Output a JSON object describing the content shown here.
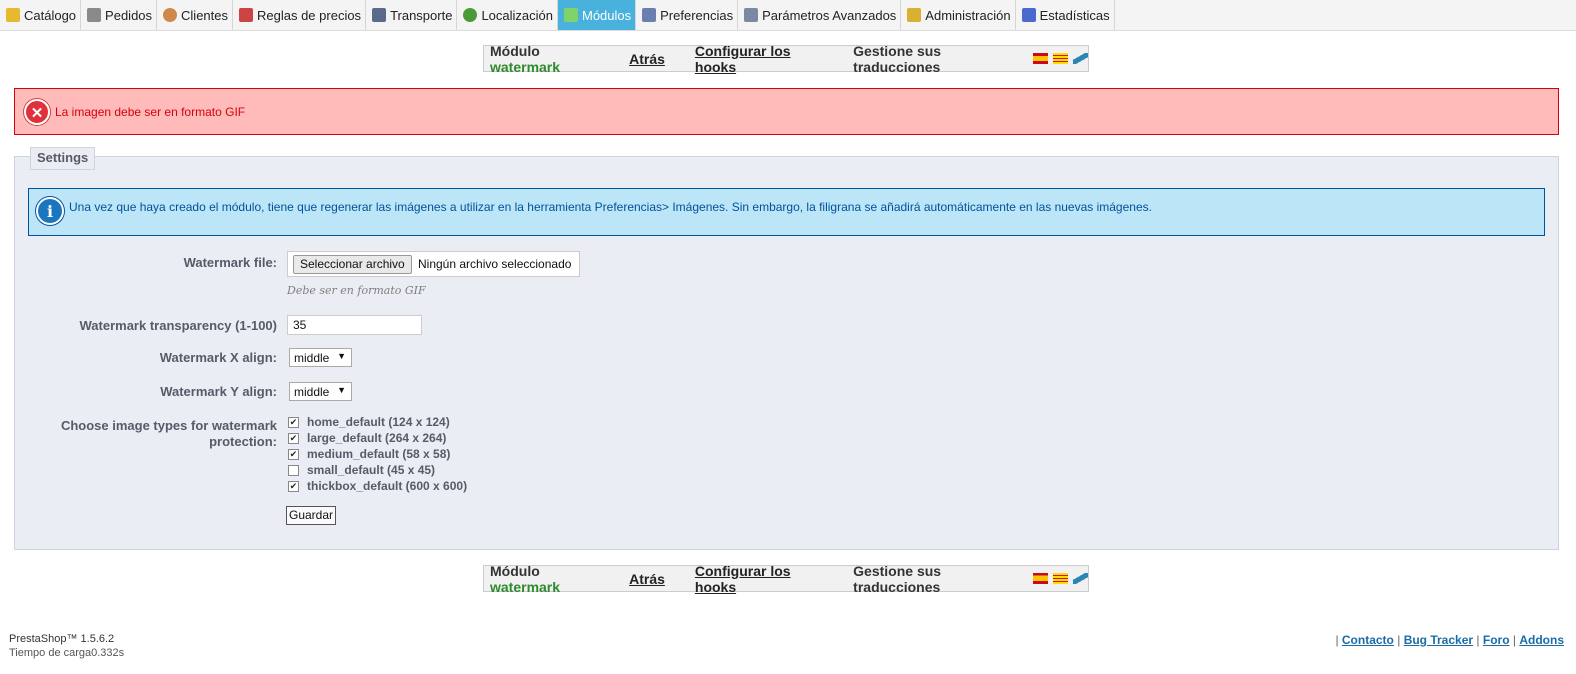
{
  "nav": {
    "tabs": [
      {
        "label": "Catálogo",
        "icon": "folder-icon",
        "color": "#e8b830"
      },
      {
        "label": "Pedidos",
        "icon": "cart-icon",
        "color": "#8a8a8a"
      },
      {
        "label": "Clientes",
        "icon": "user-icon",
        "color": "#d0884a"
      },
      {
        "label": "Reglas de precios",
        "icon": "price-tag-icon",
        "color": "#cc4444"
      },
      {
        "label": "Transporte",
        "icon": "truck-icon",
        "color": "#5a6a8a"
      },
      {
        "label": "Localización",
        "icon": "globe-icon",
        "color": "#4a9a3a"
      },
      {
        "label": "Módulos",
        "icon": "puzzle-icon",
        "color": "#7fd36a"
      },
      {
        "label": "Preferencias",
        "icon": "preferences-icon",
        "color": "#6a7fb0"
      },
      {
        "label": "Parámetros Avanzados",
        "icon": "wrench-icon",
        "color": "#7a8aa0"
      },
      {
        "label": "Administración",
        "icon": "key-icon",
        "color": "#d9b030"
      },
      {
        "label": "Estadísticas",
        "icon": "bar-chart-icon",
        "color": "#4a6ad0"
      }
    ],
    "active_index": 6,
    "active_color": "#49b2dc"
  },
  "module_bar": {
    "prefix": "Módulo",
    "module_name": "watermark",
    "back_label": "Atrás",
    "hooks_label": "Configurar los hooks",
    "translations_label": "Gestione sus traducciones",
    "flags": [
      "spain-flag-icon",
      "catalonia-flag-icon",
      "translate-feather-icon"
    ]
  },
  "error": {
    "message": "La imagen debe ser en formato GIF",
    "icon": "error-x-icon",
    "color": "#d8000c"
  },
  "settings": {
    "legend": "Settings",
    "info_message": "Una vez que haya creado el módulo, tiene que regenerar las imágenes a utilizar en la herramienta Preferencias> Imágenes. Sin embargo, la filigrana se añadirá automáticamente en las nuevas imágenes.",
    "file_label": "Watermark file:",
    "file_button": "Seleccionar archivo",
    "file_status": "Ningún archivo seleccionado",
    "file_hint": "Debe ser en formato GIF",
    "transparency_label": "Watermark transparency (1-100)",
    "transparency_value": "35",
    "x_align_label": "Watermark X align:",
    "x_align_value": "middle",
    "y_align_label": "Watermark Y align:",
    "y_align_value": "middle",
    "image_types_label_1": "Choose image types for watermark",
    "image_types_label_2": "protection:",
    "image_types": [
      {
        "label": "home_default (124 x 124)",
        "checked": true
      },
      {
        "label": "large_default (264 x 264)",
        "checked": true
      },
      {
        "label": "medium_default (58 x 58)",
        "checked": true
      },
      {
        "label": "small_default (45 x 45)",
        "checked": false
      },
      {
        "label": "thickbox_default (600 x 600)",
        "checked": true
      }
    ],
    "save_button": "Guardar"
  },
  "footer": {
    "version": "PrestaShop™ 1.5.6.2",
    "load_time": "Tiempo de carga0.332s",
    "links": [
      "Contacto",
      "Bug Tracker",
      "Foro",
      "Addons"
    ]
  }
}
